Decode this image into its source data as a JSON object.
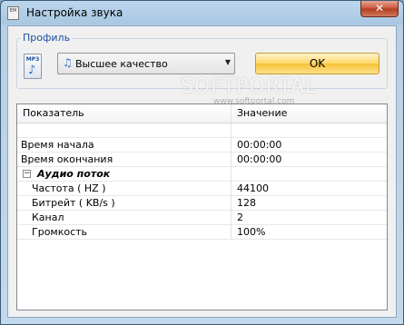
{
  "window": {
    "title": "Настройка звука",
    "close_glyph": "✕",
    "app_icon_text": "EM"
  },
  "profile": {
    "legend": "Профиль",
    "file_icon_label": "MP3",
    "selected_option": "Высшее качество",
    "ok_label": "OK"
  },
  "table": {
    "headers": [
      "Показатель",
      "Значение"
    ],
    "rows": [
      {
        "name": "",
        "value": ""
      },
      {
        "name": "Время начала",
        "value": "00:00:00"
      },
      {
        "name": "Время окончания",
        "value": "00:00:00"
      },
      {
        "name": "Аудио поток",
        "value": "",
        "group": true
      },
      {
        "name": "Частота ( HZ )",
        "value": "44100"
      },
      {
        "name": "Битрейт ( KB/s )",
        "value": "128"
      },
      {
        "name": "Канал",
        "value": "2"
      },
      {
        "name": "Громкость",
        "value": "100%"
      }
    ],
    "group_toggle": "−"
  },
  "watermark": {
    "brand": "SOFTPORTAL",
    "url": "www.softportal.com"
  }
}
